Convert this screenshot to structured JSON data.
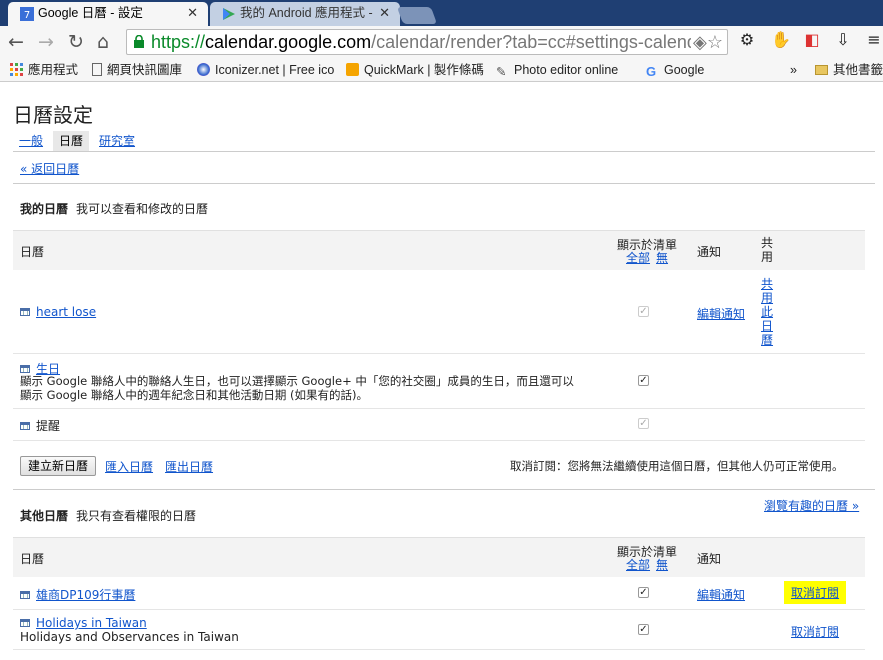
{
  "browser": {
    "tabs": [
      {
        "title": "Google 日曆 - 設定",
        "active": true,
        "favicon": "google-calendar-icon"
      },
      {
        "title": "我的 Android 應用程式 - ",
        "active": false,
        "favicon": "google-play-icon"
      }
    ],
    "url": {
      "scheme": "https://",
      "host": "calendar.google.com",
      "path": "/calendar/render?tab=cc#settings-calend"
    },
    "bookmarks": [
      {
        "label": "應用程式",
        "icon": "apps-grid-icon"
      },
      {
        "label": "網頁快訊圖庫",
        "icon": "page-icon"
      },
      {
        "label": "Iconizer.net | Free ico",
        "icon": "iconizer-icon"
      },
      {
        "label": "QuickMark | 製作條碼",
        "icon": "quickmark-icon"
      },
      {
        "label": "Photo editor online",
        "icon": "brush-icon"
      },
      {
        "label": "Google",
        "icon": "google-g-icon"
      },
      {
        "label": "»",
        "icon": ""
      },
      {
        "label": "其他書籤",
        "icon": "folder-icon"
      }
    ]
  },
  "page": {
    "title": "日曆設定",
    "tabs": [
      "一般",
      "日曆",
      "研究室"
    ],
    "back_link": "« 返回日曆"
  },
  "my_calendars": {
    "heading": "我的日曆",
    "subheading": "我可以查看和修改的日曆",
    "columns": {
      "calendar": "日曆",
      "show_in_list": "顯示於清單",
      "all": "全部",
      "none": "無",
      "notify": "通知",
      "share": "共\n用"
    },
    "rows": [
      {
        "name": "heart lose",
        "checked": true,
        "disabled": true,
        "notify": "編輯通知",
        "share": "共\n用\n此\n日\n曆"
      },
      {
        "name": "生日",
        "desc": "顯示 Google 聯絡人中的聯絡人生日，也可以選擇顯示 Google+ 中「您的社交圈」成員的生日，而且還可以\n顯示 Google 聯絡人中的週年紀念日和其他活動日期 (如果有的話)。",
        "checked": true,
        "disabled": false
      },
      {
        "name": "提醒",
        "checked": true,
        "disabled": true
      }
    ],
    "create_button": "建立新日曆",
    "import_link": "匯入日曆",
    "export_link": "匯出日曆",
    "unsubscribe_note": "取消訂閱：您將無法繼續使用這個日曆，但其他人仍可正常使用。"
  },
  "other_calendars": {
    "heading": "其他日曆",
    "subheading": "我只有查看權限的日曆",
    "browse_link": "瀏覽有趣的日曆 »",
    "columns": {
      "calendar": "日曆",
      "show_in_list": "顯示於清單",
      "all": "全部",
      "none": "無",
      "notify": "通知"
    },
    "rows": [
      {
        "name": "雄商DP109行事曆",
        "checked": true,
        "notify": "編輯通知",
        "action": "取消訂閱",
        "highlight": true
      },
      {
        "name": "Holidays in Taiwan",
        "desc": "Holidays and Observances in Taiwan",
        "checked": true,
        "action": "取消訂閱",
        "highlight": false
      }
    ]
  }
}
